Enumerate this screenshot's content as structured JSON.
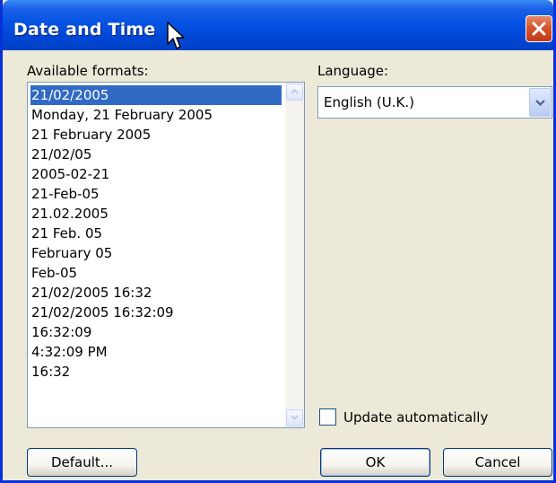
{
  "dialog": {
    "title": "Date and Time",
    "close_label": "Close"
  },
  "formats": {
    "label": "Available formats:",
    "items": [
      "21/02/2005",
      "Monday, 21 February 2005",
      "21 February 2005",
      "21/02/05",
      "2005-02-21",
      "21-Feb-05",
      "21.02.2005",
      "21 Feb. 05",
      "February 05",
      "Feb-05",
      "21/02/2005 16:32",
      "21/02/2005 16:32:09",
      "16:32:09",
      "4:32:09 PM",
      "16:32"
    ],
    "selected": "21/02/2005"
  },
  "language": {
    "label": "Language:",
    "value": "English (U.K.)"
  },
  "update_checkbox": {
    "label": "Update automatically",
    "checked": false
  },
  "buttons": {
    "default": "Default...",
    "ok": "OK",
    "cancel": "Cancel"
  },
  "colors": {
    "titlebar": "#0553e3",
    "selection": "#316ac5",
    "dialog_bg": "#ece9d8",
    "close_button": "#d5562a"
  },
  "icons": {
    "close": "close-icon",
    "cursor": "mouse-pointer-icon",
    "dropdown": "chevron-down-icon",
    "scroll_up": "scroll-up-arrow-icon",
    "scroll_down": "scroll-down-arrow-icon"
  }
}
